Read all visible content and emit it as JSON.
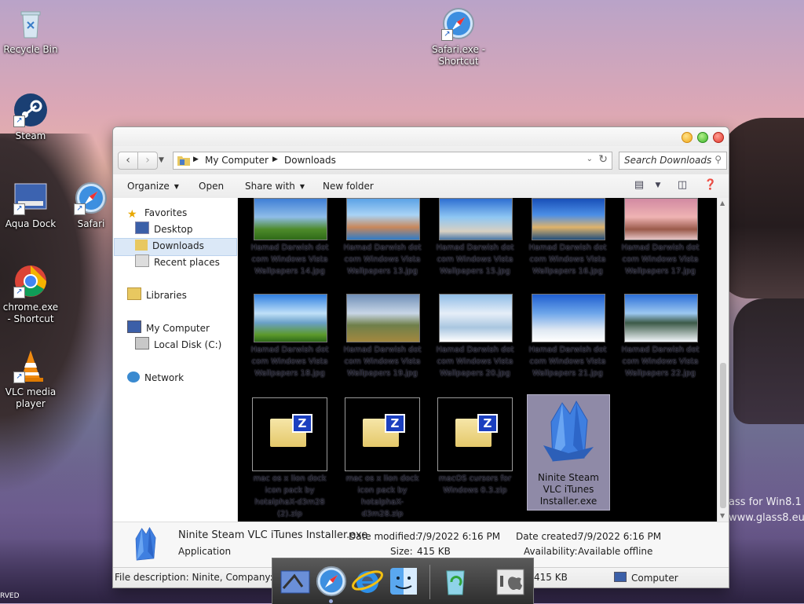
{
  "desktop": {
    "icons": [
      {
        "label": "Recycle Bin"
      },
      {
        "label": "Safari.exe - Shortcut"
      },
      {
        "label": "Steam"
      },
      {
        "label": "Aqua Dock"
      },
      {
        "label": "Safari"
      },
      {
        "label": "chrome.exe - Shortcut"
      },
      {
        "label": "VLC media player"
      }
    ],
    "watermark_line1": "ass for Win8.1",
    "watermark_line2": "www.glass8.eu",
    "corner_text": "RVED"
  },
  "window": {
    "address": {
      "crumbs": [
        "My Computer",
        "Downloads"
      ]
    },
    "search_placeholder": "Search Downloads",
    "toolbar": {
      "organize": "Organize",
      "open": "Open",
      "share_with": "Share with",
      "new_folder": "New folder"
    },
    "sidebar": {
      "favorites": "Favorites",
      "desktop": "Desktop",
      "downloads": "Downloads",
      "recent_places": "Recent places",
      "libraries": "Libraries",
      "my_computer": "My Computer",
      "local_disk": "Local Disk (C:)",
      "network": "Network"
    },
    "files": {
      "row1": [
        "Hamad Darwish dot com Windows Vista Wallpapers 14.jpg",
        "Hamad Darwish dot com Windows Vista Wallpapers 13.jpg",
        "Hamad Darwish dot com Windows Vista Wallpapers 15.jpg",
        "Hamad Darwish dot com Windows Vista Wallpapers 16.jpg",
        "Hamad Darwish dot com Windows Vista Wallpapers 17.jpg"
      ],
      "row2": [
        "Hamad Darwish dot com Windows Vista Wallpapers 18.jpg",
        "Hamad Darwish dot com Windows Vista Wallpapers 19.jpg",
        "Hamad Darwish dot com Windows Vista Wallpapers 20.jpg",
        "Hamad Darwish dot com Windows Vista Wallpapers 21.jpg",
        "Hamad Darwish dot com Windows Vista Wallpapers 22.jpg"
      ],
      "row3": [
        "mac os x lion dock icon pack by hotalphaX-d3m28 (2).zip",
        "mac os x lion dock icon pack by hotalphaX-d3m28.zip",
        "macOS cursors for Windows 0.3.zip"
      ],
      "selected": "Ninite Steam VLC iTunes Installer.exe"
    },
    "details": {
      "name": "Ninite Steam VLC iTunes Installer.exe",
      "type": "Application",
      "date_modified_label": "Date modified:",
      "date_modified": "7/9/2022 6:16 PM",
      "size_label": "Size:",
      "size": "415 KB",
      "date_created_label": "Date created:",
      "date_created": "7/9/2022 6:16 PM",
      "availability_label": "Availability:",
      "availability": "Available offline"
    },
    "status": {
      "description": "File description: Ninite, Company: Se",
      "size": "415 KB",
      "location": "Computer"
    }
  },
  "colors": {
    "selection": "#dbe8f7",
    "accent": "#1a5fc4"
  }
}
